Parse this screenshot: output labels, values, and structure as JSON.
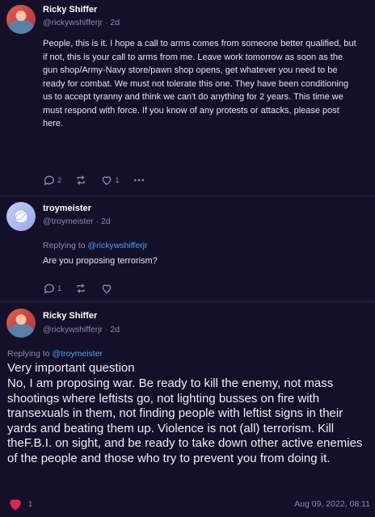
{
  "post1": {
    "name": "Ricky Shiffer",
    "handle": "@rickywshifferjr",
    "time": "2d",
    "text": "People, this is it.  I hope a call to arms comes from someone better qualified, but if not, this is your call to arms from me.  Leave work tomorrow as soon as the gun shop/Army-Navy store/pawn shop opens, get whatever you need to be ready for combat.  We must not tolerate this one.  They have been conditioning us to accept tyranny and think we can't do anything for 2 years.  This time we must respond with force.  If you know of any protests or attacks, please post here.",
    "reply_count": "2",
    "like_count": "1"
  },
  "post2": {
    "name": "troymeister",
    "handle": "@troymeister",
    "time": "2d",
    "replying_label": "Replying to",
    "replying_to": "@rickywshifferjr",
    "text": "Are you proposing terrorism?",
    "reply_count": "1"
  },
  "post3": {
    "name": "Ricky Shiffer",
    "handle": "@rickywshifferjr",
    "time": "2d",
    "replying_label": "Replying to",
    "replying_to": "@troymeister",
    "title": "Very important question",
    "text": "No, I am proposing war.  Be ready to kill the enemy, not mass shootings where leftists go, not lighting busses on fire with transexuals in them, not finding people with leftist signs in their yards and beating them up.  Violence is not (all) terrorism.  Kill theF.B.I. on sight, and be ready to take down other active enemies of the people and those who try to prevent you from doing it.",
    "like_count": "1",
    "timestamp": "Aug 09, 2022, 08:11"
  },
  "separator": "·",
  "icons": {
    "reply": "reply-bubble-icon",
    "repost": "repost-arrows-icon",
    "like": "heart-icon",
    "more": "more-dots-icon"
  },
  "colors": {
    "background": "#14102a",
    "accent_link": "#4ea1f7",
    "like_active": "#e0245e",
    "muted": "#8e8aa8"
  }
}
